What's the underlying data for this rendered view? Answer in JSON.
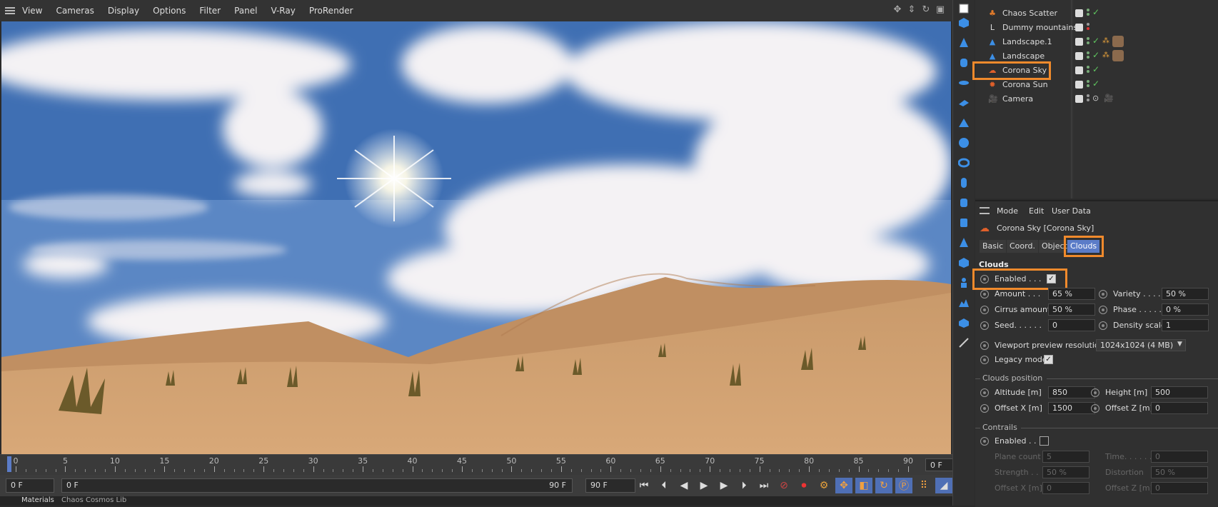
{
  "menu": {
    "items": [
      "View",
      "Cameras",
      "Display",
      "Options",
      "Filter",
      "Panel",
      "V-Ray",
      "ProRender"
    ]
  },
  "objects": [
    {
      "name": "Chaos Scatter"
    },
    {
      "name": "Dummy mountains"
    },
    {
      "name": "Landscape.1"
    },
    {
      "name": "Landscape"
    },
    {
      "name": "Corona Sky"
    },
    {
      "name": "Corona Sun"
    },
    {
      "name": "Camera"
    }
  ],
  "attr": {
    "menu": [
      "Mode",
      "Edit",
      "User Data"
    ],
    "title": "Corona Sky [Corona Sky]",
    "tabs": [
      "Basic",
      "Coord.",
      "Object",
      "Clouds"
    ],
    "section": "Clouds",
    "enabled_label": "Enabled . . .",
    "amount_label": "Amount . . .",
    "amount": "65 %",
    "variety_label": "Variety . . . .",
    "variety": "50 %",
    "cirrus_label": "Cirrus amount",
    "cirrus": "50 %",
    "phase_label": "Phase . . . . .",
    "phase": "0 %",
    "seed_label": "Seed. . . . . .",
    "seed": "0",
    "density_label": "Density scale",
    "density": "1",
    "vp_res_label": "Viewport preview resolution",
    "vp_res": "1024x1024 (4 MB)",
    "legacy_label": "Legacy mode",
    "clouds_pos": "Clouds position",
    "altitude_label": "Altitude [m]",
    "altitude": "850",
    "height_label": "Height [m]",
    "height": "500",
    "offx_label": "Offset X [m]",
    "offx": "1500",
    "offz_label": "Offset Z [m]",
    "offz": "0",
    "contrails": "Contrails",
    "c_enabled_label": "Enabled . .",
    "plane_label": "Plane count",
    "plane": "5",
    "time_label": "Time. . . . . .",
    "time": "0",
    "strength_label": "Strength . .",
    "strength": "50 %",
    "distortion_label": "Distortion",
    "distortion": "50 %",
    "c_offx_label": "Offset X [m]",
    "c_offx": "0",
    "c_offz_label": "Offset Z [m]",
    "c_offz": "0"
  },
  "timeline": {
    "ticks": [
      "0",
      "5",
      "10",
      "15",
      "20",
      "25",
      "30",
      "35",
      "40",
      "45",
      "50",
      "55",
      "60",
      "65",
      "70",
      "75",
      "80",
      "85",
      "90"
    ],
    "end_field": "0 F"
  },
  "transport": {
    "current": "0 F",
    "range_start": "0 F",
    "range_end": "90 F",
    "max": "90 F"
  },
  "bottom_tabs": [
    "Materials",
    "Chaos Cosmos Lib"
  ]
}
